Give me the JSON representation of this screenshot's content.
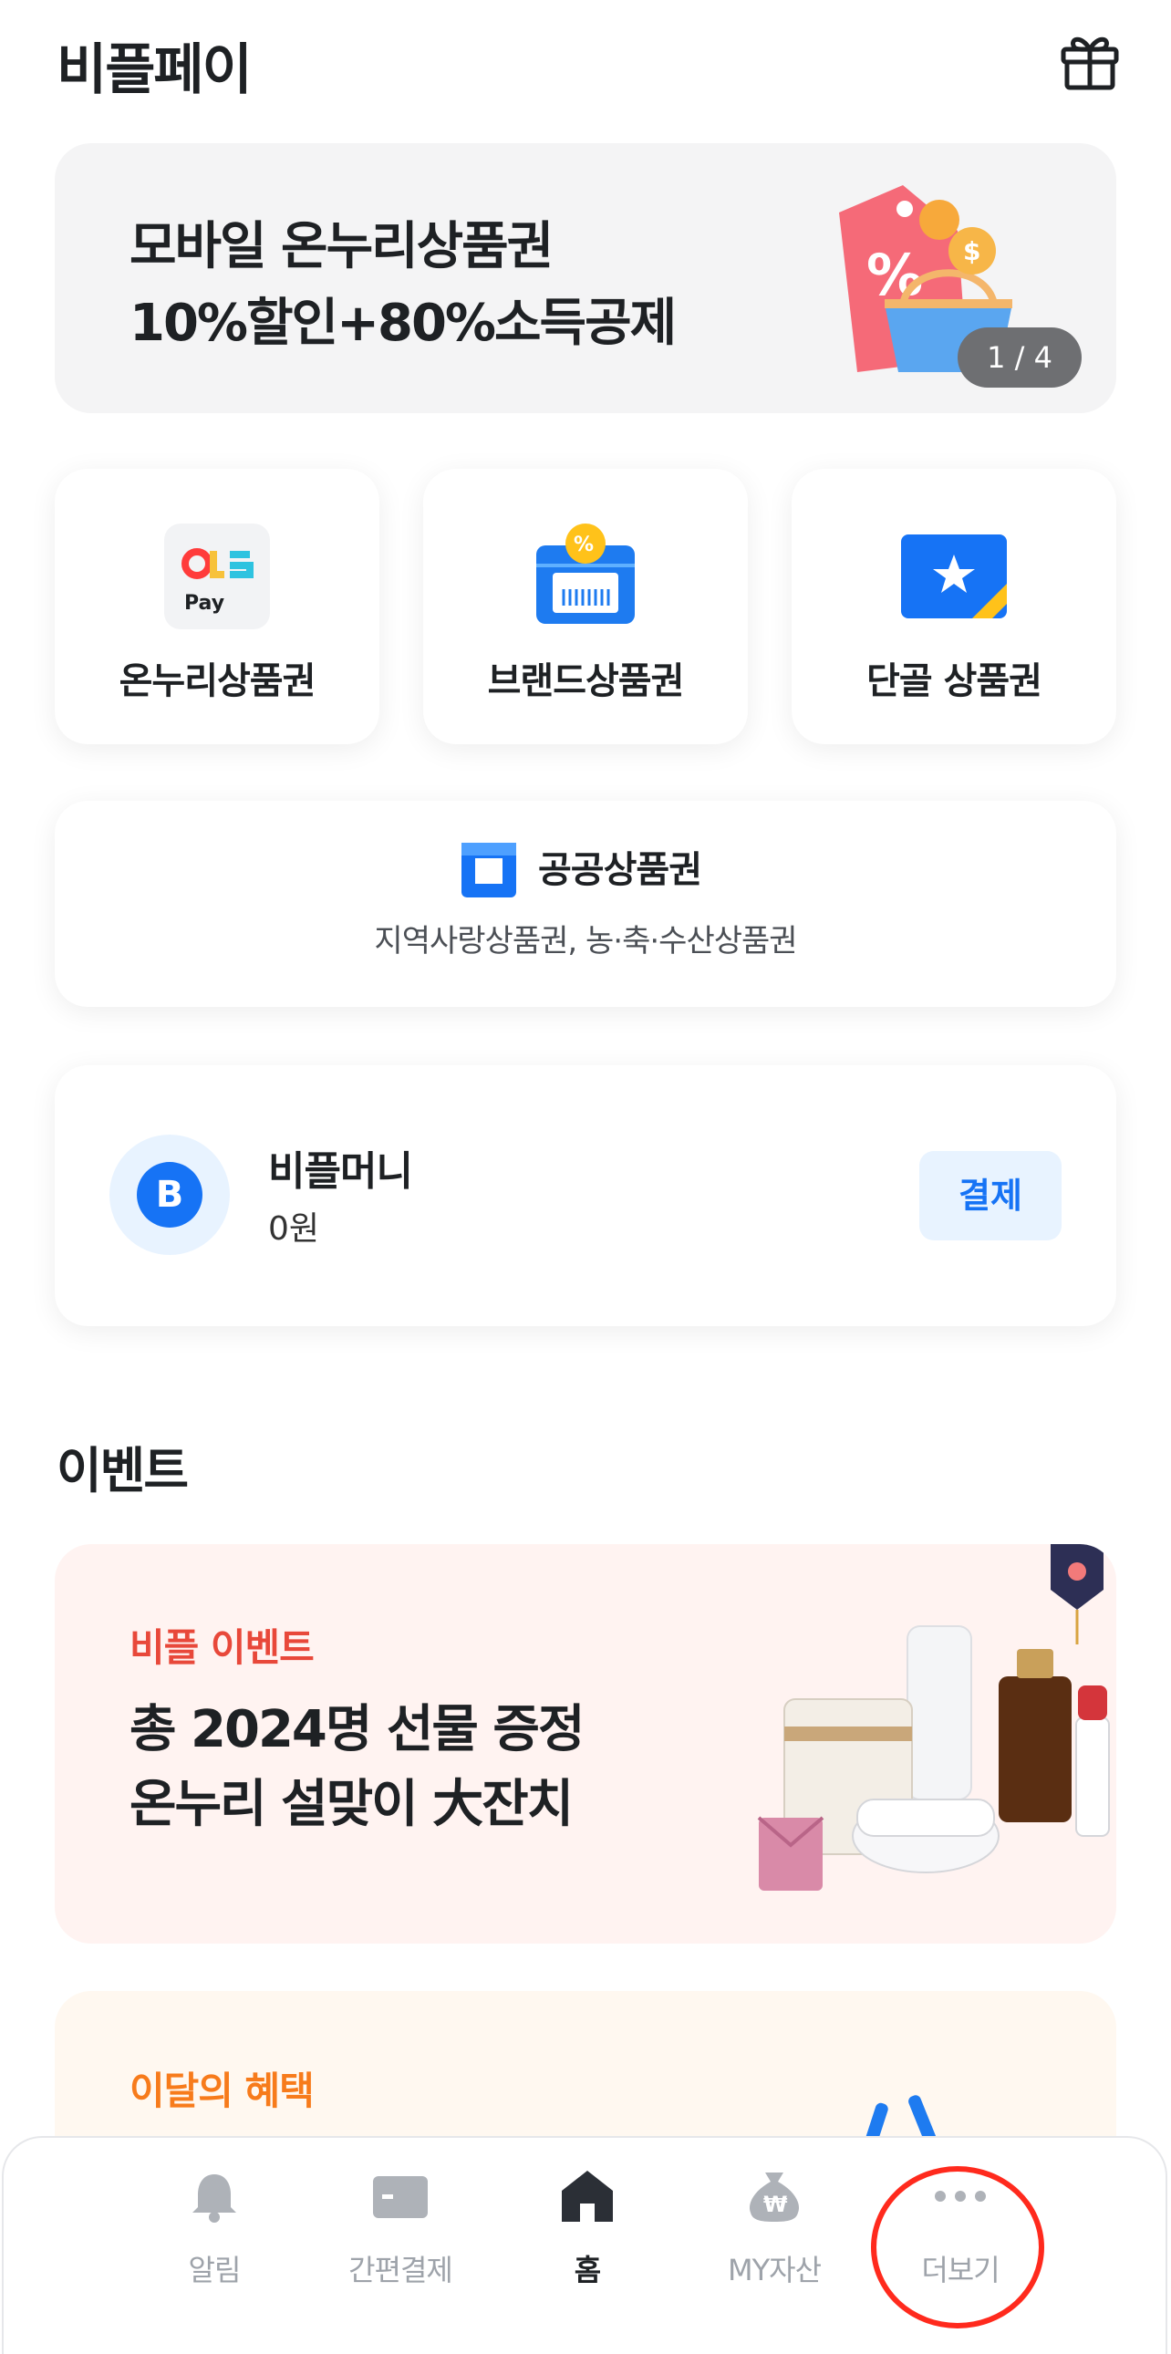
{
  "header": {
    "title": "비플페이",
    "gift_icon": "gift-icon"
  },
  "promo": {
    "line1": "모바일 온누리상품권",
    "line2": "10%할인+80%소득공제",
    "page_indicator": "1 / 4",
    "colors": {
      "background": "#f4f4f5",
      "indicator": "#6e6f72"
    }
  },
  "services": [
    {
      "label": "온누리상품권",
      "icon": "onnuri-pay-icon"
    },
    {
      "label": "브랜드상품권",
      "icon": "brand-voucher-icon"
    },
    {
      "label": "단골 상품권",
      "icon": "regular-voucher-icon"
    }
  ],
  "public_voucher": {
    "title": "공공상품권",
    "subtitle": "지역사랑상품권, 농·축·수산상품권",
    "icon": "public-voucher-icon"
  },
  "bplmoney": {
    "avatar_letter": "B",
    "name": "비플머니",
    "balance": "0원",
    "pay_label": "결제",
    "accent": "#1673f5"
  },
  "events_section": {
    "title": "이벤트"
  },
  "event_banner": {
    "tag": "비플 이벤트",
    "headline1": "총 2024명 선물 증정",
    "headline2": "온누리 설맞이 大잔치",
    "colors": {
      "background": "#fff3f1",
      "tag": "#e8483a"
    }
  },
  "benefit_banner": {
    "tag": "이달의 혜택",
    "colors": {
      "background": "#fff8f0",
      "tag": "#f77b1b"
    }
  },
  "tabbar": {
    "items": [
      {
        "label": "알림",
        "icon": "bell-icon",
        "active": false
      },
      {
        "label": "간편결제",
        "icon": "card-icon",
        "active": false
      },
      {
        "label": "홈",
        "icon": "home-icon",
        "active": true
      },
      {
        "label": "MY자산",
        "icon": "money-bag-icon",
        "active": false
      },
      {
        "label": "더보기",
        "icon": "more-dots-icon",
        "active": false
      }
    ],
    "highlight_color": "#ff2a1d"
  }
}
